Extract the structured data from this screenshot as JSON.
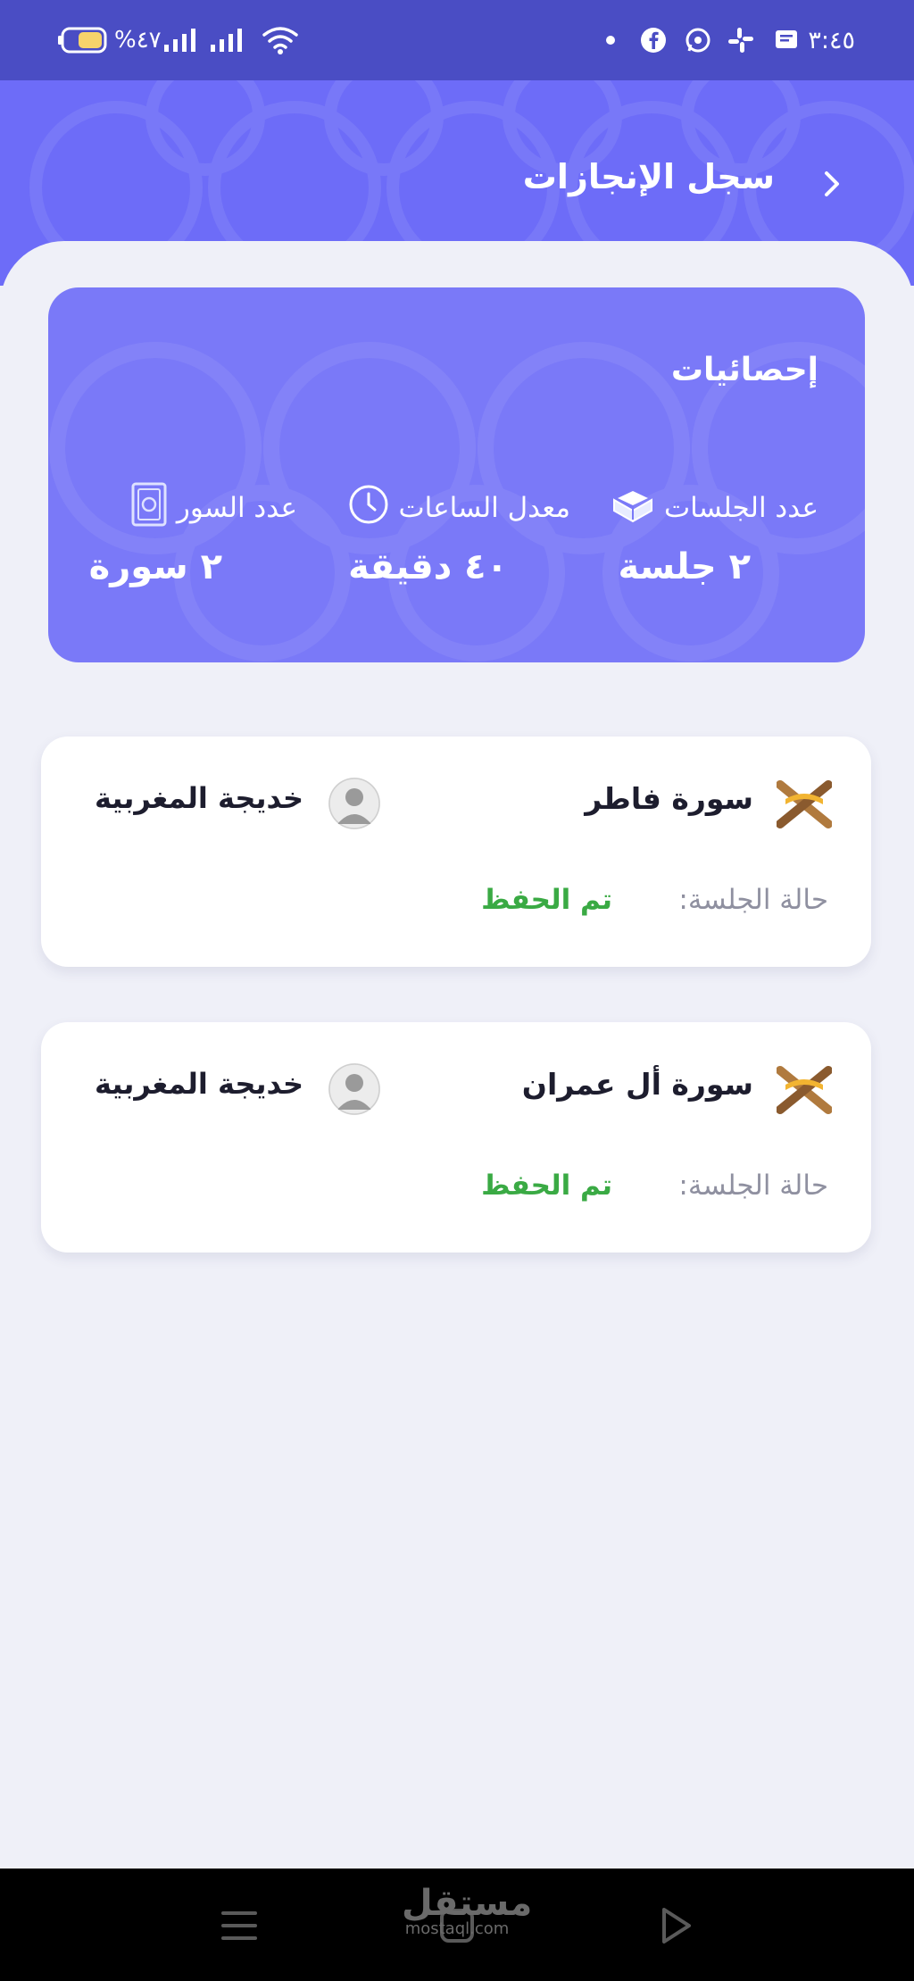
{
  "status_bar": {
    "time": "٣:٤٥",
    "battery_text": "%٤٧",
    "icons": [
      "dot-icon",
      "facebook-icon",
      "whatsapp-icon",
      "slack-icon",
      "message-icon",
      "wifi-icon",
      "signal-icon",
      "battery-icon"
    ]
  },
  "header": {
    "title": "سجل الإنجازات",
    "back_icon": "chevron-right-icon"
  },
  "stats": {
    "title": "إحصائيات",
    "items": [
      {
        "label": "عدد الجلسات",
        "value": "٢ جلسة",
        "icon": "open-quran-icon"
      },
      {
        "label": "معدل الساعات",
        "value": "٤٠ دقيقة",
        "icon": "clock-icon"
      },
      {
        "label": "عدد السور",
        "value": "٢ سورة",
        "icon": "quran-book-icon"
      }
    ]
  },
  "sessions": [
    {
      "surah": "سورة فاطر",
      "teacher": "خديجة المغربية",
      "status_label": "حالة الجلسة:",
      "status_value": "تم الحفظ"
    },
    {
      "surah": "سورة أل عمران",
      "teacher": "خديجة المغربية",
      "status_label": "حالة الجلسة:",
      "status_value": "تم الحفظ"
    }
  ],
  "nav_bar": {
    "buttons": [
      "menu-icon",
      "home-icon",
      "back-triangle-icon"
    ]
  },
  "watermark": {
    "arabic": "مستقل",
    "latin": "mostaql.com"
  },
  "colors": {
    "status_bar": "#4a4dc4",
    "header": "#6d6cf8",
    "stats_card": "#7a79f8",
    "background": "#eff0f8",
    "status_green": "#3aaa44"
  }
}
